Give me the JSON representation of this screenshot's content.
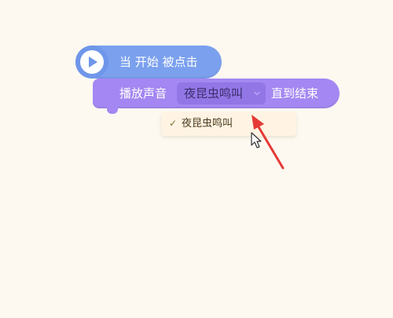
{
  "hat_block": {
    "label": "当 开始 被点击",
    "color": "#7aa0ee",
    "icon": "play-icon"
  },
  "sound_block": {
    "label_play": "播放声音",
    "selected_sound": "夜昆虫鸣叫",
    "label_until": "直到结束",
    "color": "#a487f2"
  },
  "dropdown_menu": {
    "items": [
      {
        "label": "夜昆虫鸣叫",
        "checked": true,
        "icon": "check-icon"
      }
    ]
  },
  "annotation": {
    "arrow_color": "#e53935",
    "icon": "mouse-cursor-icon"
  }
}
